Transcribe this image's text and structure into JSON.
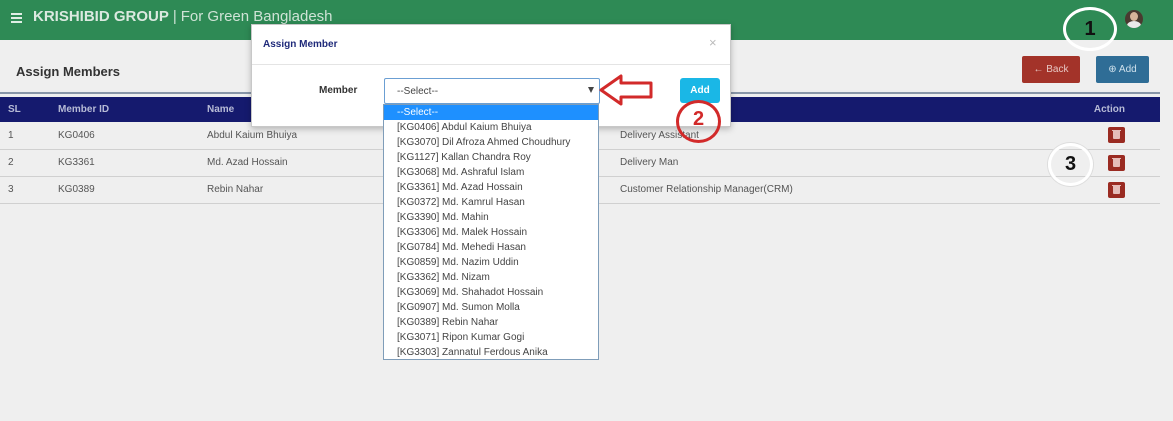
{
  "topbar": {
    "brand_bold": "KRISHIBID GROUP",
    "brand_separator": "|",
    "brand_tagline": "For Green Bangladesh"
  },
  "page": {
    "title": "Assign Members",
    "back_label": "Back",
    "add_label": "Add",
    "table": {
      "headers": [
        "SL",
        "Member ID",
        "Name",
        "",
        "Action"
      ],
      "rows": [
        {
          "sl": "1",
          "member_id": "KG0406",
          "name": "Abdul Kaium Bhuiya",
          "role": "Delivery Assistant"
        },
        {
          "sl": "2",
          "member_id": "KG3361",
          "name": "Md. Azad Hossain",
          "role": "Delivery Man"
        },
        {
          "sl": "3",
          "member_id": "KG0389",
          "name": "Rebin Nahar",
          "role": "Customer Relationship Manager(CRM)"
        }
      ]
    }
  },
  "modal": {
    "title": "Assign Member",
    "close_glyph": "×",
    "field_label": "Member",
    "select_value": "--Select--",
    "add_label": "Add",
    "options": [
      "--Select--",
      "[KG0406] Abdul Kaium Bhuiya",
      "[KG3070] Dil Afroza Ahmed Choudhury",
      "[KG1127] Kallan Chandra Roy",
      "[KG3068] Md. Ashraful Islam",
      "[KG3361] Md. Azad Hossain",
      "[KG0372] Md. Kamrul Hasan",
      "[KG3390] Md. Mahin",
      "[KG3306] Md. Malek Hossain",
      "[KG0784] Md. Mehedi Hasan",
      "[KG0859] Md. Nazim Uddin",
      "[KG3362] Md. Nizam",
      "[KG3069] Md. Shahadot Hossain",
      "[KG0907] Md. Sumon Molla",
      "[KG0389] Rebin Nahar",
      "[KG3071] Ripon Kumar Gogi",
      "[KG3303] Zannatul Ferdous Anika"
    ]
  },
  "annotations": {
    "marker_1": "1",
    "marker_2": "2",
    "marker_3": "3"
  },
  "colors": {
    "topbar": "#2e8a55",
    "table_header": "#151a6e",
    "back_button": "#a33329",
    "add_button_top": "#2f6d96",
    "add_button_modal": "#1ab7e6",
    "delete_button": "#9a2b22",
    "annotation_red": "#d22a2a"
  },
  "icons": {
    "menu": "hamburger-icon",
    "back": "arrow-left-icon",
    "add": "plus-circle-icon",
    "delete": "trash-icon",
    "dropdown": "caret-down-icon"
  }
}
